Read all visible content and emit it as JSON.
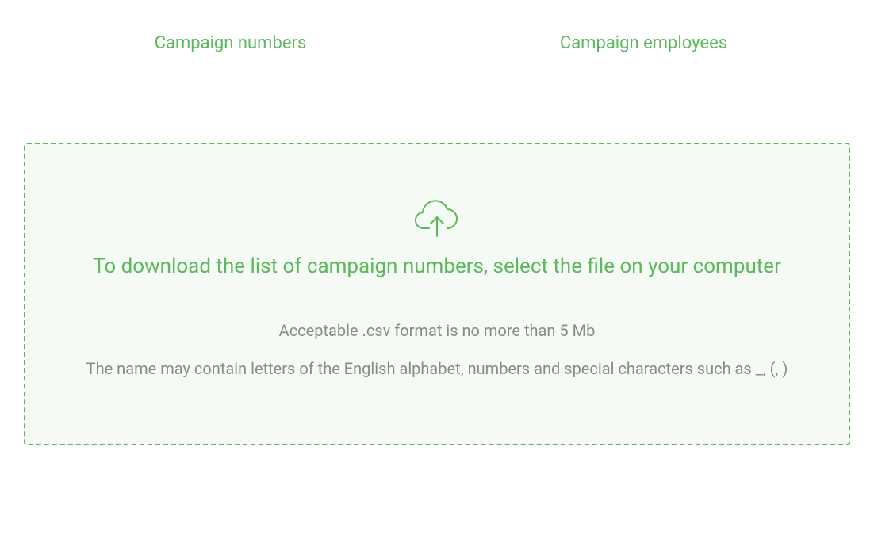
{
  "tabs": [
    {
      "label": "Campaign numbers"
    },
    {
      "label": "Campaign employees"
    }
  ],
  "dropzone": {
    "title": "To download the list of campaign numbers, select the file on your computer",
    "hint_format": "Acceptable .csv format is no more than 5 Mb",
    "hint_name": "The name may contain letters of the English alphabet, numbers and special characters such as _, (, )"
  }
}
